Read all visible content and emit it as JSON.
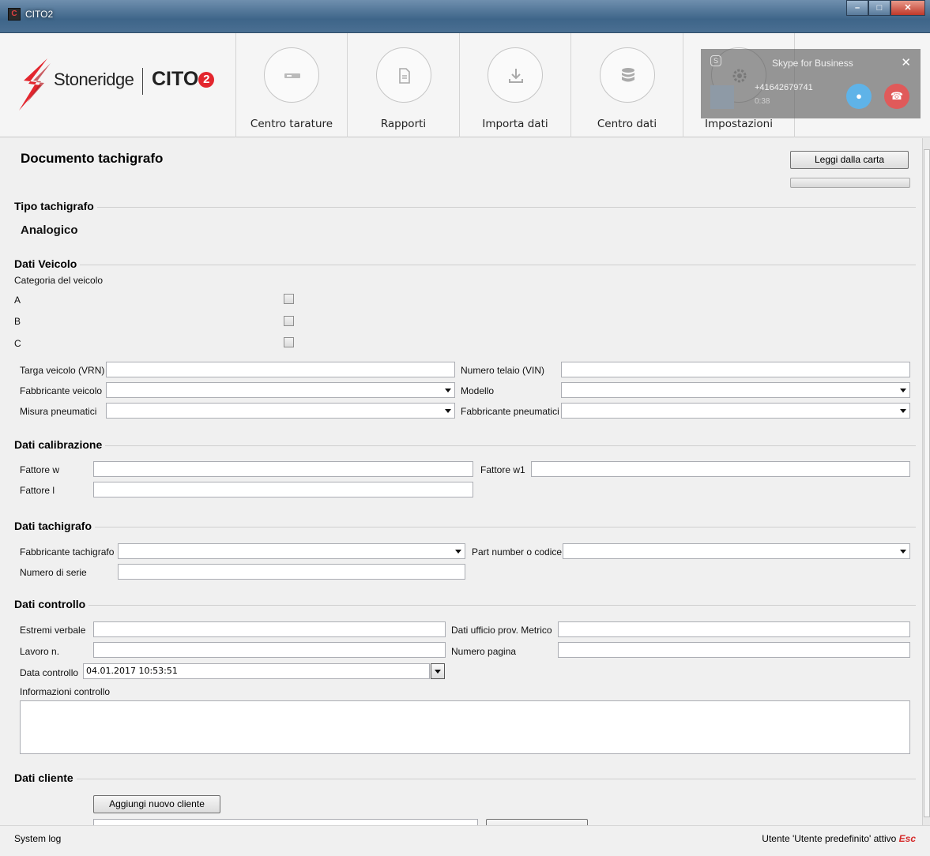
{
  "window": {
    "title": "CITO2",
    "icon_text": "C"
  },
  "brand": {
    "company": "Stoneridge",
    "product": "CITO",
    "product_suffix": "2"
  },
  "toolbar": {
    "items": [
      {
        "label": "Centro tarature",
        "icon": "card-reader-icon"
      },
      {
        "label": "Rapporti",
        "icon": "document-icon"
      },
      {
        "label": "Importa dati",
        "icon": "download-icon"
      },
      {
        "label": "Centro dati",
        "icon": "database-icon"
      },
      {
        "label": "Impostazioni",
        "icon": "gear-icon"
      }
    ]
  },
  "skype": {
    "title": "Skype for Business",
    "number": "+41642679741",
    "duration": "0:38"
  },
  "document": {
    "title": "Documento tachigrafo",
    "read_card_button": "Leggi dalla carta"
  },
  "tipo": {
    "section": "Tipo tachigrafo",
    "value": "Analogico"
  },
  "veicolo": {
    "section": "Dati Veicolo",
    "category_label": "Categoria del veicolo",
    "categories": [
      "A",
      "B",
      "C"
    ],
    "vrn_label": "Targa veicolo (VRN)",
    "vrn_value": "",
    "vin_label": "Numero telaio (VIN)",
    "vin_value": "",
    "manufacturer_label": "Fabbricante veicolo",
    "model_label": "Modello",
    "tyre_size_label": "Misura pneumatici",
    "tyre_manufacturer_label": "Fabbricante pneumatici"
  },
  "calibrazione": {
    "section": "Dati calibrazione",
    "w_label": "Fattore w",
    "w1_label": "Fattore w1",
    "l_label": "Fattore l"
  },
  "tachigrafo": {
    "section": "Dati tachigrafo",
    "manufacturer_label": "Fabbricante tachigrafo",
    "part_label": "Part number o codice",
    "serial_label": "Numero di serie"
  },
  "controllo": {
    "section": "Dati controllo",
    "verbale_label": "Estremi verbale",
    "ufficio_label": "Dati ufficio prov. Metrico",
    "lavoro_label": "Lavoro n.",
    "pagina_label": "Numero pagina",
    "data_label": "Data controllo",
    "data_value": "04.01.2017 10:53:51",
    "info_label": "Informazioni controllo"
  },
  "cliente": {
    "section": "Dati cliente",
    "add_button": "Aggiungi nuovo cliente"
  },
  "status": {
    "left": "System log",
    "right": "Utente 'Utente predefinito' attivo",
    "esc": "Esc"
  },
  "colors": {
    "accent": "#e3262e",
    "titlebar": "#3e6589",
    "background": "#f0f0f0"
  }
}
